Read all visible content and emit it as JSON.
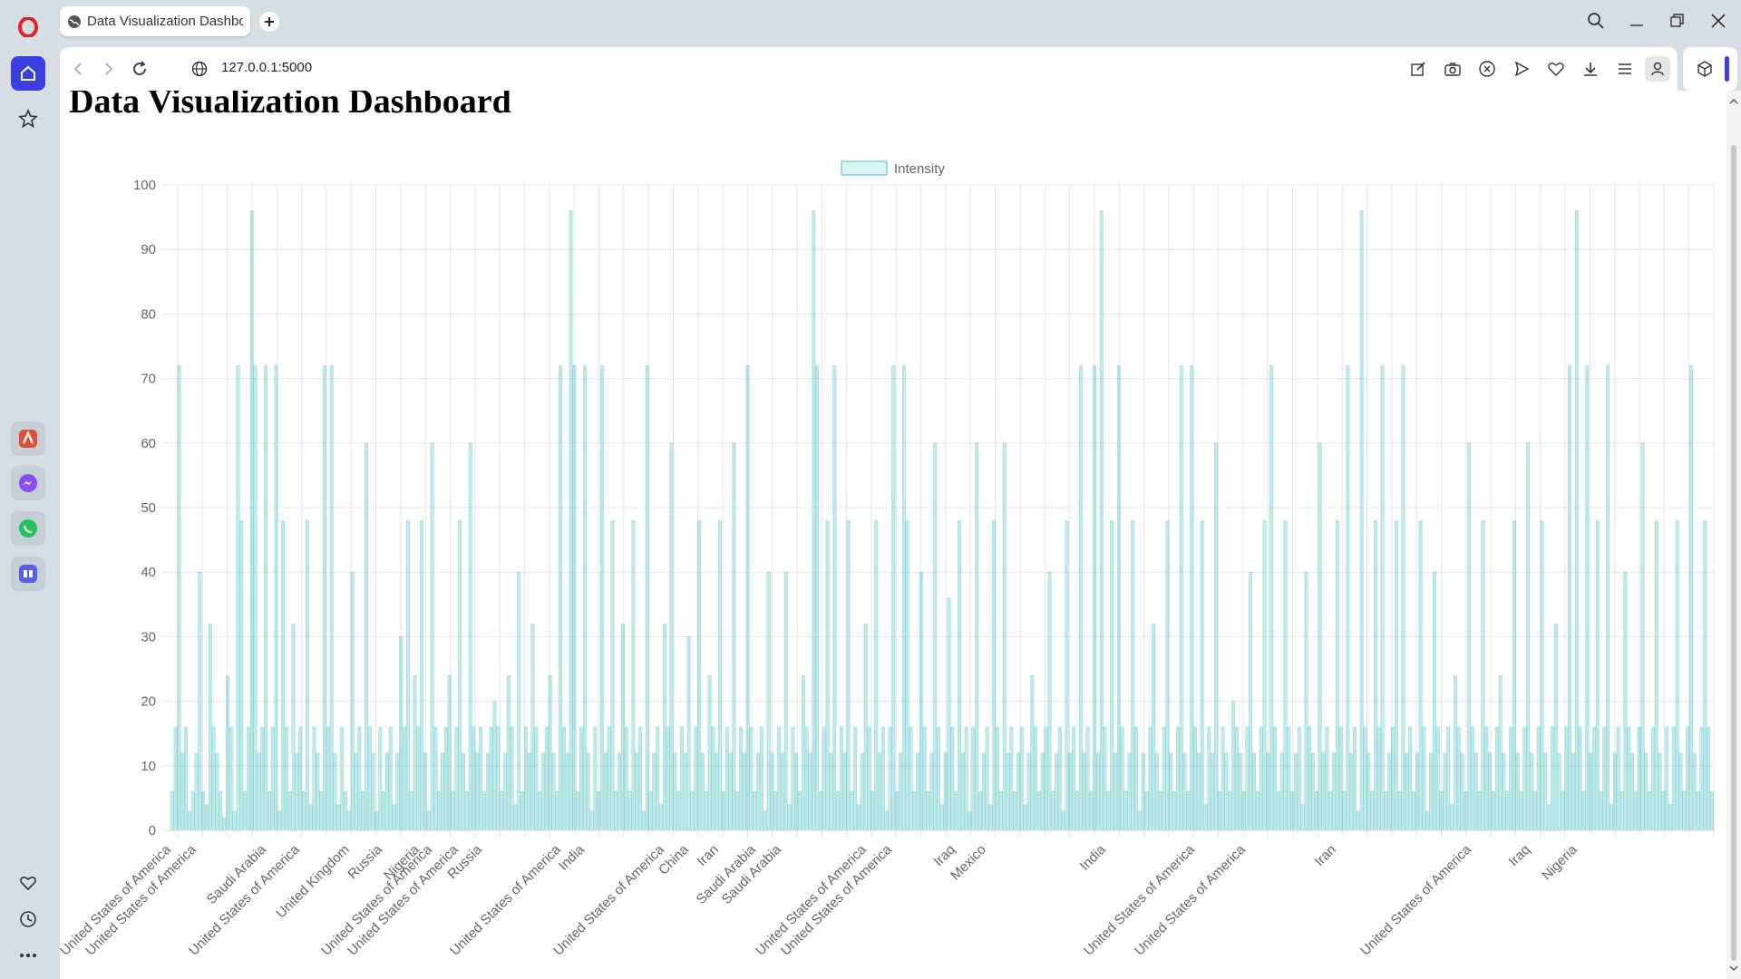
{
  "browser": {
    "tab_title": "Data Visualization Dashbo",
    "url": "127.0.0.1:5000"
  },
  "page": {
    "title": "Data Visualization Dashboard"
  },
  "chart_data": {
    "type": "bar",
    "legend": {
      "label": "Intensity",
      "placement": "top-center"
    },
    "color": "#4bc0c0",
    "ylim": [
      0,
      100
    ],
    "yticks": [
      0,
      10,
      20,
      30,
      40,
      50,
      60,
      70,
      80,
      90,
      100
    ],
    "x_tick_labels": [
      "United States of America",
      "United States of America",
      "Saudi Arabia",
      "United States of America",
      "United Kingdom",
      "Russia",
      "Nigeria",
      "United States of America",
      "United States of America",
      "Russia",
      "United States of America",
      "India",
      "United States of America",
      "China",
      "Iran",
      "Saudi Arabia",
      "Saudi Arabia",
      "United States of America",
      "United States of America",
      "Iraq",
      "Mexico",
      "India",
      "United States of America",
      "United States of America",
      "Iran",
      "United States of America",
      "Iraq",
      "Nigeria"
    ],
    "grid": true,
    "series": [
      {
        "name": "Intensity",
        "values": [
          6,
          16,
          72,
          12,
          16,
          3,
          6,
          12,
          40,
          6,
          4,
          32,
          16,
          12,
          6,
          2,
          24,
          16,
          3,
          72,
          48,
          6,
          16,
          96,
          72,
          12,
          16,
          72,
          6,
          16,
          72,
          3,
          48,
          16,
          6,
          32,
          12,
          16,
          6,
          48,
          4,
          16,
          12,
          6,
          72,
          16,
          72,
          12,
          4,
          16,
          6,
          3,
          40,
          12,
          16,
          6,
          60,
          16,
          12,
          3,
          16,
          6,
          12,
          16,
          4,
          12,
          30,
          16,
          48,
          6,
          24,
          16,
          48,
          12,
          3,
          60,
          16,
          6,
          12,
          16,
          24,
          6,
          16,
          48,
          12,
          6,
          60,
          16,
          12,
          16,
          6,
          12,
          16,
          20,
          16,
          6,
          12,
          24,
          16,
          4,
          40,
          6,
          16,
          12,
          32,
          16,
          6,
          12,
          16,
          24,
          12,
          6,
          72,
          16,
          12,
          96,
          72,
          6,
          16,
          72,
          12,
          3,
          16,
          6,
          72,
          12,
          16,
          48,
          6,
          12,
          32,
          16,
          6,
          48,
          12,
          16,
          3,
          72,
          6,
          12,
          16,
          4,
          32,
          16,
          60,
          12,
          6,
          16,
          12,
          30,
          6,
          16,
          48,
          12,
          6,
          24,
          16,
          12,
          48,
          6,
          16,
          12,
          60,
          6,
          16,
          12,
          72,
          16,
          6,
          12,
          16,
          3,
          40,
          12,
          6,
          16,
          12,
          40,
          4,
          16,
          12,
          6,
          24,
          16,
          12,
          96,
          72,
          6,
          16,
          48,
          12,
          72,
          6,
          16,
          12,
          48,
          6,
          16,
          4,
          12,
          32,
          16,
          6,
          48,
          12,
          16,
          3,
          16,
          72,
          6,
          12,
          72,
          48,
          16,
          6,
          12,
          40,
          16,
          6,
          12,
          60,
          16,
          4,
          12,
          36,
          16,
          6,
          48,
          12,
          16,
          3,
          16,
          60,
          6,
          12,
          16,
          4,
          48,
          16,
          6,
          60,
          12,
          16,
          6,
          12,
          16,
          4,
          12,
          24,
          16,
          6,
          12,
          16,
          40,
          6,
          12,
          16,
          3,
          48,
          12,
          16,
          6,
          72,
          12,
          16,
          6,
          72,
          12,
          96,
          16,
          6,
          48,
          12,
          72,
          16,
          6,
          12,
          48,
          16,
          3,
          12,
          6,
          16,
          32,
          12,
          6,
          16,
          48,
          12,
          6,
          16,
          72,
          12,
          6,
          72,
          16,
          12,
          48,
          4,
          16,
          12,
          60,
          6,
          16,
          12,
          6,
          20,
          16,
          12,
          6,
          16,
          40,
          12,
          6,
          16,
          48,
          12,
          72,
          16,
          6,
          12,
          48,
          16,
          6,
          12,
          16,
          4,
          40,
          16,
          12,
          6,
          60,
          12,
          16,
          6,
          12,
          48,
          16,
          6,
          72,
          12,
          16,
          3,
          96,
          16,
          12,
          6,
          48,
          16,
          72,
          6,
          12,
          16,
          48,
          6,
          72,
          12,
          16,
          6,
          12,
          48,
          16,
          3,
          12,
          40,
          16,
          6,
          12,
          16,
          4,
          24,
          16,
          12,
          6,
          60,
          16,
          12,
          6,
          48,
          16,
          12,
          6,
          16,
          24,
          12,
          6,
          16,
          48,
          12,
          6,
          16,
          60,
          12,
          6,
          16,
          48,
          12,
          4,
          16,
          32,
          12,
          6,
          16,
          72,
          12,
          96,
          16,
          6,
          72,
          12,
          16,
          48,
          6,
          16,
          72,
          4,
          12,
          16,
          6,
          40,
          16,
          12,
          6,
          16,
          60,
          12,
          6,
          16,
          48,
          12,
          6,
          16,
          4,
          16,
          48,
          12,
          6,
          16,
          72,
          12,
          6,
          16,
          48,
          16,
          6
        ]
      }
    ]
  }
}
